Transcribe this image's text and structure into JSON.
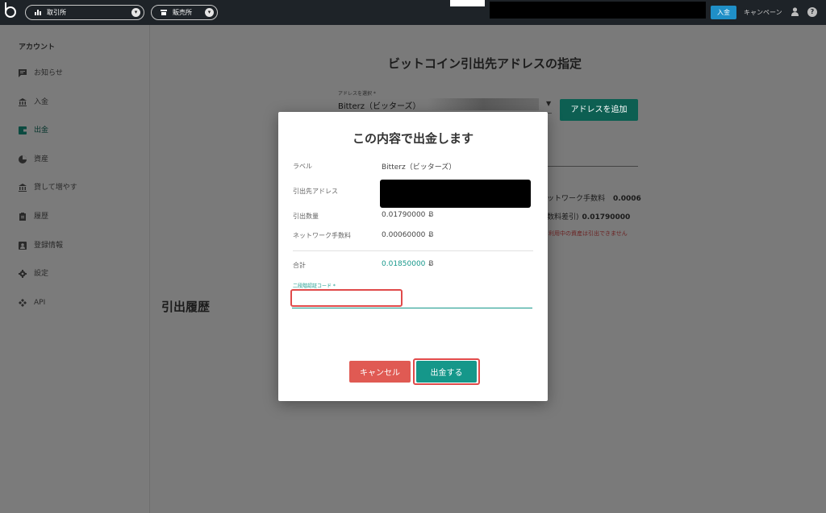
{
  "topbar": {
    "exchange_label": "取引所",
    "store_label": "販売所",
    "deposit_label": "入金",
    "campaign_label": "キャンペーン",
    "help_glyph": "?"
  },
  "sidebar": {
    "title": "アカウント",
    "items": [
      {
        "label": "お知らせ",
        "icon": "message-icon"
      },
      {
        "label": "入金",
        "icon": "bank-icon"
      },
      {
        "label": "出金",
        "icon": "wallet-icon"
      },
      {
        "label": "資産",
        "icon": "pie-chart-icon"
      },
      {
        "label": "貸して増やす",
        "icon": "bank-icon"
      },
      {
        "label": "履歴",
        "icon": "clipboard-icon"
      },
      {
        "label": "登録情報",
        "icon": "contact-card-icon"
      },
      {
        "label": "設定",
        "icon": "gear-icon"
      },
      {
        "label": "API",
        "icon": "api-icon"
      }
    ],
    "active_index": 2
  },
  "main": {
    "page_title": "ビットコイン引出先アドレスの指定",
    "address_select_label": "アドレスを選択 *",
    "address_select_value": "Bitterz（ビッターズ）",
    "add_address_button": "アドレスを追加",
    "fee_label_partial": "ットワーク手数料",
    "fee_value": "0.0006",
    "net_label_partial": "数料差引)",
    "net_value": "0.01790000",
    "warning_partial": "利用中の資産は引出できません",
    "history_title": "引出履歴"
  },
  "modal": {
    "title": "この内容で出金します",
    "label_label": "ラベル",
    "label_value": "Bitterz（ビッターズ）",
    "address_label": "引出先アドレス",
    "amount_label": "引出数量",
    "amount_value": "0.01790000",
    "fee_label": "ネットワーク手数料",
    "fee_value": "0.00060000",
    "total_label": "合計",
    "total_value": "0.01850000",
    "btc_symbol": "Ƀ",
    "twofa_label": "二段階認証コード *",
    "twofa_value": "",
    "cancel_button": "キャンセル",
    "submit_button": "出金する"
  },
  "colors": {
    "teal": "#15978a",
    "cancel_red": "#e05a53",
    "deposit_blue": "#1f8fc7",
    "topbar": "#1e2328"
  }
}
